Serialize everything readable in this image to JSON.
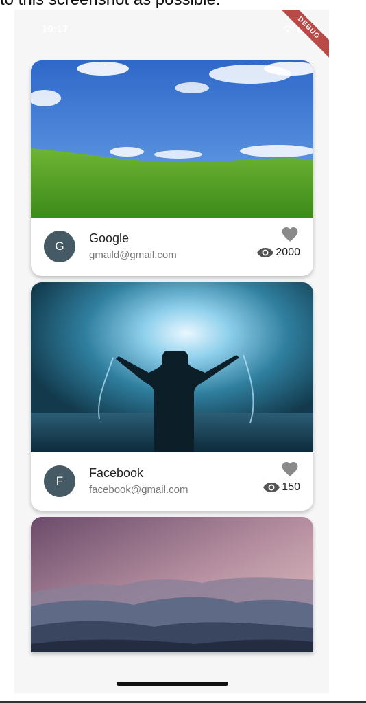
{
  "caption": "to this screenshot as possible:",
  "status_bar": {
    "time": "10:17",
    "debug_label": "DEBUG"
  },
  "cards": [
    {
      "avatar_letter": "G",
      "title": "Google",
      "subtitle": "gmaild@gmail.com",
      "views": "2000",
      "image": "green-hill-sky"
    },
    {
      "avatar_letter": "F",
      "title": "Facebook",
      "subtitle": "facebook@gmail.com",
      "views": "150",
      "image": "man-in-water"
    },
    {
      "image": "misty-mountains"
    }
  ],
  "icons": [
    "heart-icon",
    "eye-icon",
    "wifi-icon",
    "battery-icon"
  ],
  "colors": {
    "avatar_bg": "#455a64",
    "heart": "#8a8a8a",
    "debug_ribbon": "#b94a48",
    "background": "#f6f6f6"
  }
}
